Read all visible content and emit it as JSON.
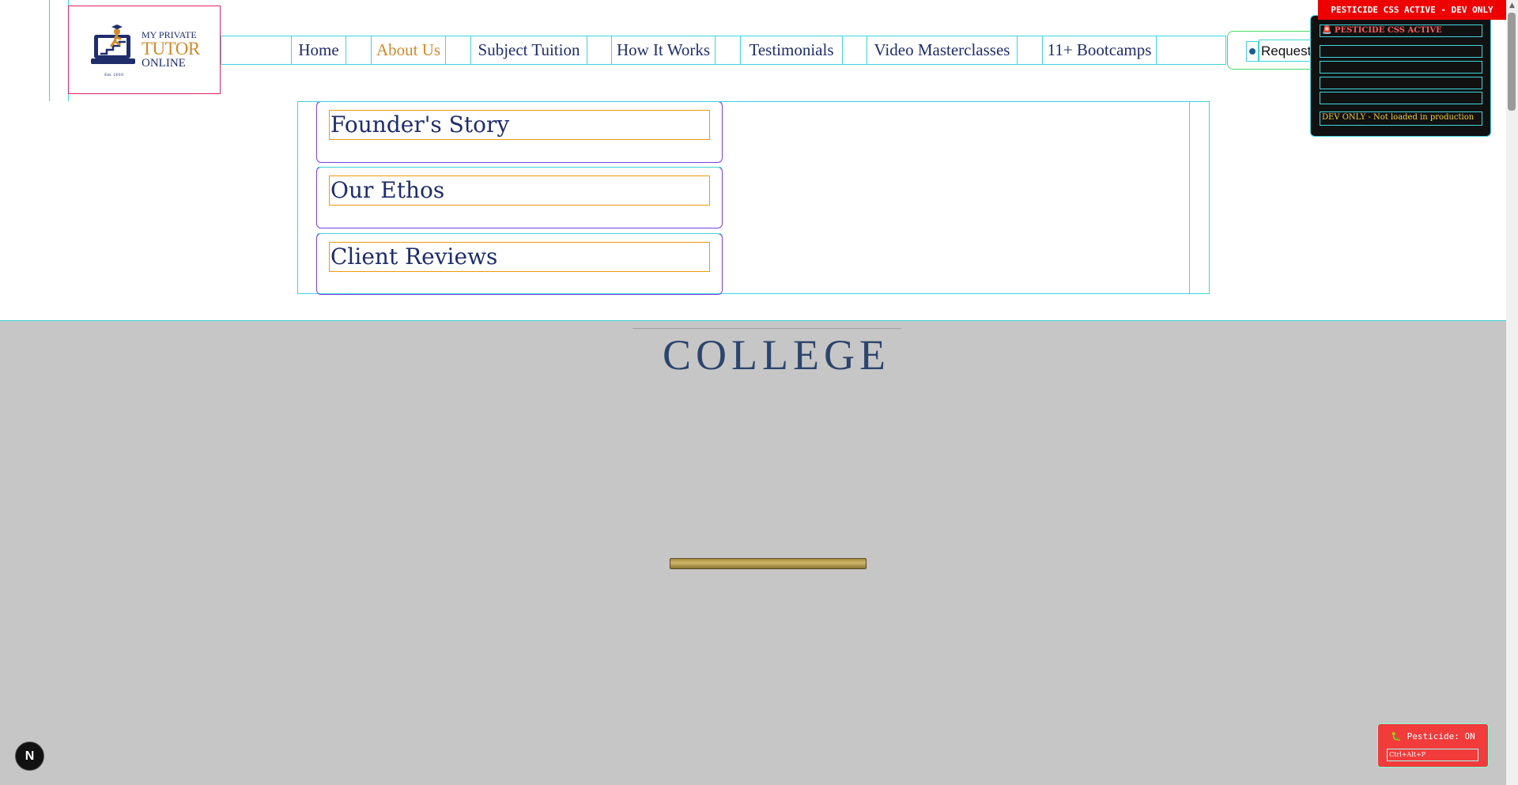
{
  "logo": {
    "line1": "MY PRIVATE",
    "line2": "TUTOR",
    "line3": "ONLINE",
    "est": "Est. 2010"
  },
  "nav": {
    "items": [
      {
        "label": "Home",
        "active": false
      },
      {
        "label": "About Us",
        "active": true
      },
      {
        "label": "Subject Tuition",
        "active": false
      },
      {
        "label": "How It Works",
        "active": false
      },
      {
        "label": "Testimonials",
        "active": false
      },
      {
        "label": "Video Masterclasses",
        "active": false
      },
      {
        "label": "11+ Bootcamps",
        "active": false
      }
    ],
    "request_label": "Request"
  },
  "dropdown": {
    "items": [
      "Founder's Story",
      "Our Ethos",
      "Client Reviews"
    ]
  },
  "hero": {
    "word": "COLLEGE"
  },
  "pesticide": {
    "banner": "PESTICIDE CSS ACTIVE - DEV ONLY",
    "panel_title": "🚨 PESTICIDE CSS ACTIVE",
    "panel_note": "DEV ONLY - Not loaded in production",
    "toggle_label": "🐛 Pesticide: ON",
    "toggle_hint": "Ctrl+Alt+P"
  },
  "next_badge": "N",
  "colors": {
    "navy": "#1f2d6b",
    "gold": "#d08a2a",
    "debug_cyan": "#3dd7dc",
    "debug_red": "#f23b3b"
  }
}
